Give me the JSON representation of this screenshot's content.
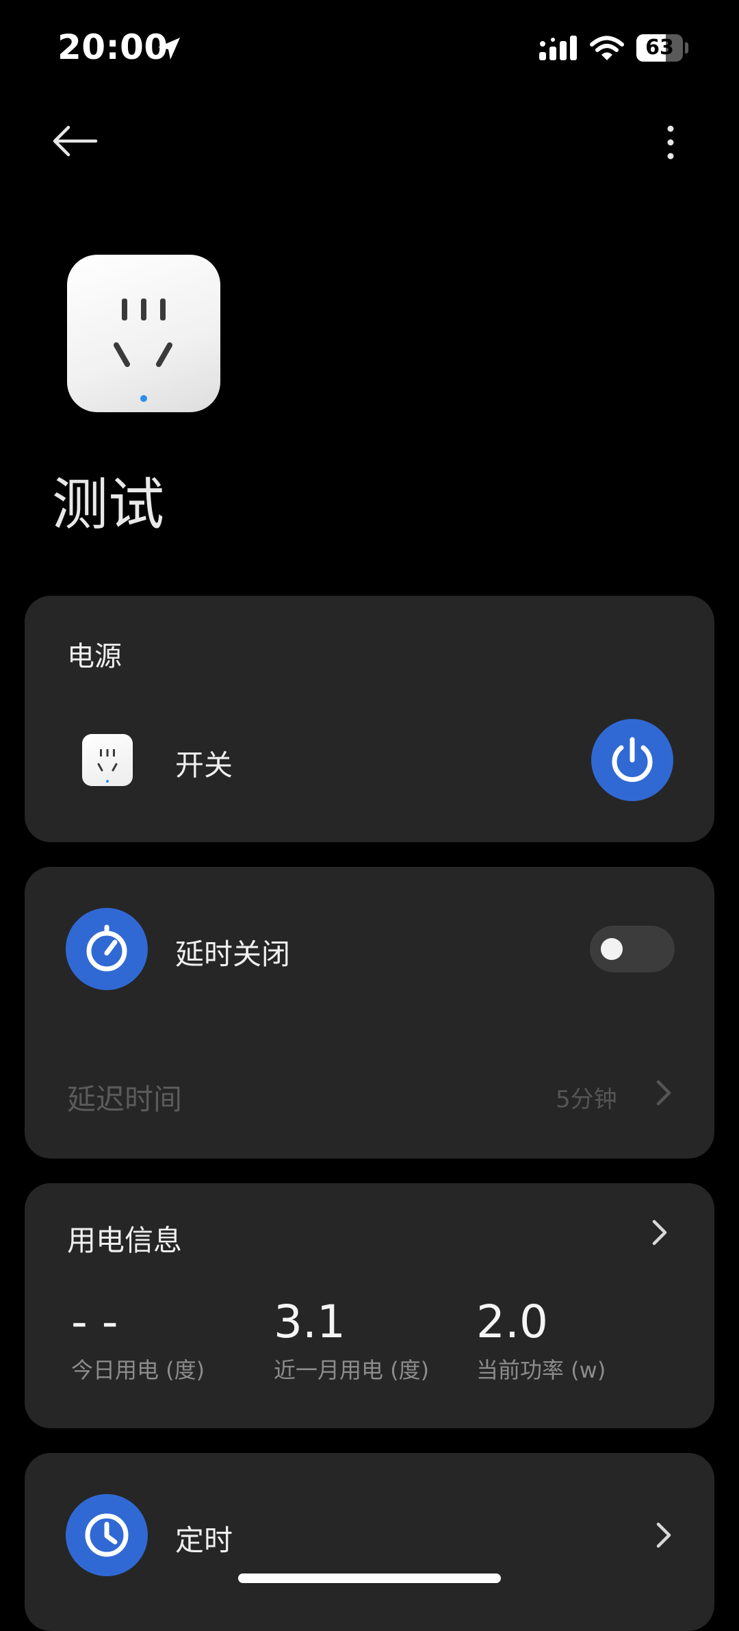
{
  "status_bar": {
    "time": "20:00",
    "battery": "63",
    "icons": [
      "location-arrow-icon",
      "cellular-signal-icon",
      "wifi-icon",
      "battery-icon"
    ]
  },
  "nav": {
    "back_icon": "back-arrow-icon",
    "more_icon": "more-vertical-icon"
  },
  "device": {
    "name": "测试",
    "image_icon": "socket-icon"
  },
  "power_card": {
    "title": "电源",
    "switch_label": "开关",
    "power_icon": "power-icon",
    "state": "on",
    "accent": "#3169d4"
  },
  "delay_card": {
    "label": "延时关闭",
    "timer_icon": "stopwatch-icon",
    "toggle_on": false,
    "delay_time_label": "延迟时间",
    "delay_time_value": "5分钟"
  },
  "usage_card": {
    "title": "用电信息",
    "stats": [
      {
        "value": "- -",
        "label": "今日用电 (度)"
      },
      {
        "value": "3.1",
        "label": "近一月用电 (度)"
      },
      {
        "value": "2.0",
        "label": "当前功率 (w)"
      }
    ]
  },
  "timer_card": {
    "label": "定时",
    "clock_icon": "clock-icon"
  },
  "colors": {
    "background": "#000000",
    "card": "#262626",
    "accent": "#3169d4"
  }
}
